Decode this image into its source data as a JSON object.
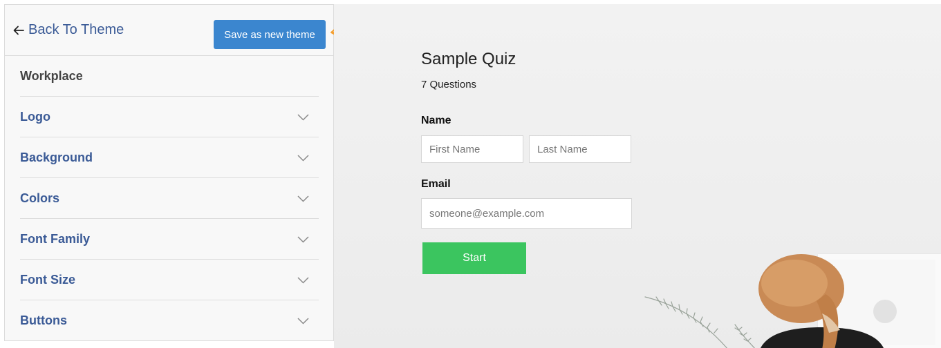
{
  "sidebar": {
    "back_label": "Back To Theme",
    "save_button": "Save as new theme",
    "sections": [
      {
        "label": "Workplace"
      },
      {
        "label": "Logo"
      },
      {
        "label": "Background"
      },
      {
        "label": "Colors"
      },
      {
        "label": "Font Family"
      },
      {
        "label": "Font Size"
      },
      {
        "label": "Buttons"
      }
    ]
  },
  "quiz": {
    "title": "Sample Quiz",
    "question_count": "7 Questions",
    "name_label": "Name",
    "first_name_placeholder": "First Name",
    "last_name_placeholder": "Last Name",
    "email_label": "Email",
    "email_placeholder": "someone@example.com",
    "start_button": "Start"
  },
  "colors": {
    "link": "#3a5a96",
    "save_button": "#3b86cf",
    "start_button": "#3bc55f",
    "annotation_arrow": "#f5a031"
  },
  "icons": {
    "back": "arrow-left-icon",
    "section": "chevron-down-icon"
  }
}
